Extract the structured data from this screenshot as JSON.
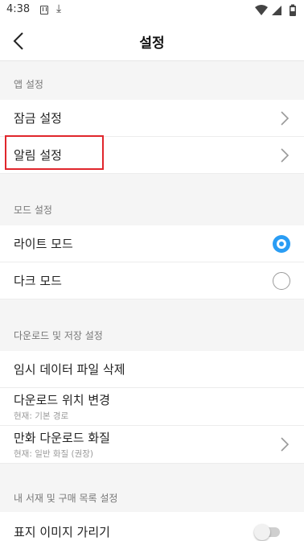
{
  "status_bar": {
    "time": "4:38",
    "icons": [
      "app-notification-icon",
      "download-icon",
      "wifi-icon",
      "signal-icon",
      "battery-icon"
    ]
  },
  "header": {
    "title": "설정",
    "back_icon": "chevron-left-icon"
  },
  "sections": {
    "app": {
      "label": "앱 설정",
      "items": [
        {
          "label": "잠금 설정",
          "icon": "chevron-right-icon"
        },
        {
          "label": "알림 설정",
          "icon": "chevron-right-icon"
        }
      ]
    },
    "mode": {
      "label": "모드 설정",
      "items": [
        {
          "label": "라이트 모드",
          "selected": true
        },
        {
          "label": "다크 모드",
          "selected": false
        }
      ]
    },
    "download": {
      "label": "다운로드 및 저장 설정",
      "items": [
        {
          "label": "임시 데이터 파일 삭제"
        },
        {
          "label": "다운로드 위치 변경",
          "sub": "현재: 기본 경로"
        },
        {
          "label": "만화 다운로드 화질",
          "sub": "현재: 일반 화질 (권장)",
          "icon": "chevron-right-icon"
        }
      ]
    },
    "library": {
      "label": "내 서재 및 구매 목록 설정",
      "items": [
        {
          "label": "표지 이미지 가리기",
          "toggle": false
        }
      ]
    }
  },
  "colors": {
    "accent": "#2a9df4",
    "highlight": "#e0262c",
    "background": "#f5f5f5"
  }
}
